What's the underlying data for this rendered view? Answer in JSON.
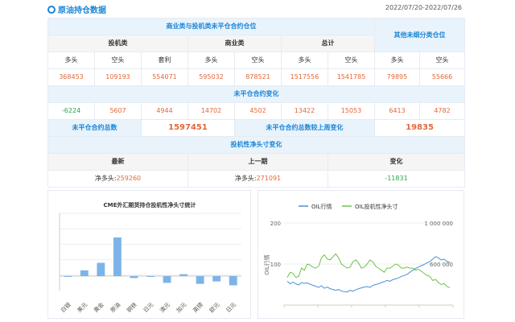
{
  "header": {
    "title": "原油持仓数据",
    "date_range": "2022/07/20-2022/07/26"
  },
  "table": {
    "main_title": "商业类与投机类未平仓合约仓位",
    "other_title": "其他未细分类仓位",
    "groups": [
      "投机类",
      "商业类",
      "总计"
    ],
    "subheaders": [
      "多头",
      "空头",
      "套利",
      "多头",
      "空头",
      "多头",
      "空头",
      "多头",
      "空头"
    ],
    "positions": [
      "368453",
      "109193",
      "554071",
      "595032",
      "878521",
      "1517556",
      "1541785",
      "79895",
      "55666"
    ],
    "change_title": "未平仓合约变化",
    "changes": [
      "-6224",
      "5607",
      "4944",
      "14702",
      "4502",
      "13422",
      "15053",
      "6413",
      "4782"
    ],
    "total_label": "未平仓合约总数",
    "total_value": "1597451",
    "weekly_label": "未平仓合约总数较上周变化",
    "weekly_value": "19835",
    "spec_title": "投机性净头寸变化",
    "spec_headers": [
      "最新",
      "上一期",
      "变化"
    ],
    "latest_prefix": "净多头:",
    "latest_value": "259260",
    "prev_prefix": "净多头:",
    "prev_value": "271091",
    "change_value": "-11831"
  },
  "chart_data": [
    {
      "type": "bar",
      "title": "CME外汇期货持仓投机性净头寸统计",
      "categories": [
        "白银",
        "美元",
        "黄金",
        "原油",
        "铜铁",
        "日元",
        "澳元",
        "加元",
        "英镑",
        "欧元",
        "日元"
      ],
      "values": [
        -3000,
        24000,
        55000,
        160000,
        -8000,
        -2000,
        -28000,
        8000,
        -32000,
        -22000,
        -38000
      ],
      "ylim": [
        -60000,
        260000
      ],
      "grid": true,
      "bar_color": "#7cb3e9"
    },
    {
      "type": "line",
      "legend": [
        "OIL行情",
        "OIL投机性净头寸"
      ],
      "legend_position": "top-center",
      "ylabel": "OIL行情",
      "left_ticks": [
        "200",
        "100"
      ],
      "right_ticks": [
        "1 000 000",
        "600 000"
      ],
      "left_ylim": [
        0,
        200
      ],
      "right_ylim": [
        200000,
        1000000
      ],
      "colors": [
        "#4a90d9",
        "#6cc24a"
      ],
      "series": [
        {
          "name": "OIL行情",
          "values": [
            58,
            52,
            56,
            52,
            49,
            55,
            53,
            54,
            51,
            48,
            46,
            43,
            47,
            41,
            44,
            40,
            38,
            36,
            38,
            34,
            33,
            32,
            36,
            34,
            37,
            40,
            42,
            44,
            45,
            43,
            48,
            50,
            52,
            55,
            57,
            60,
            58,
            62,
            64,
            66,
            70,
            72,
            75,
            80,
            85,
            89,
            93,
            96,
            99,
            103,
            106,
            112,
            118,
            115,
            110,
            112,
            106,
            104
          ]
        },
        {
          "name": "OIL投机性净头寸",
          "values": [
            470000,
            520000,
            510000,
            470000,
            480000,
            560000,
            540000,
            600000,
            590000,
            570000,
            560000,
            580000,
            660000,
            690000,
            650000,
            640000,
            670000,
            700000,
            660000,
            600000,
            580000,
            560000,
            570000,
            620000,
            640000,
            610000,
            560000,
            570000,
            600000,
            640000,
            620000,
            580000,
            560000,
            540000,
            520000,
            560000,
            560000,
            580000,
            600000,
            590000,
            560000,
            560000,
            570000,
            560000,
            560000,
            540000,
            550000,
            530000,
            510000,
            490000,
            480000,
            440000,
            450000,
            420000,
            400000,
            410000,
            380000,
            370000
          ]
        }
      ]
    }
  ]
}
